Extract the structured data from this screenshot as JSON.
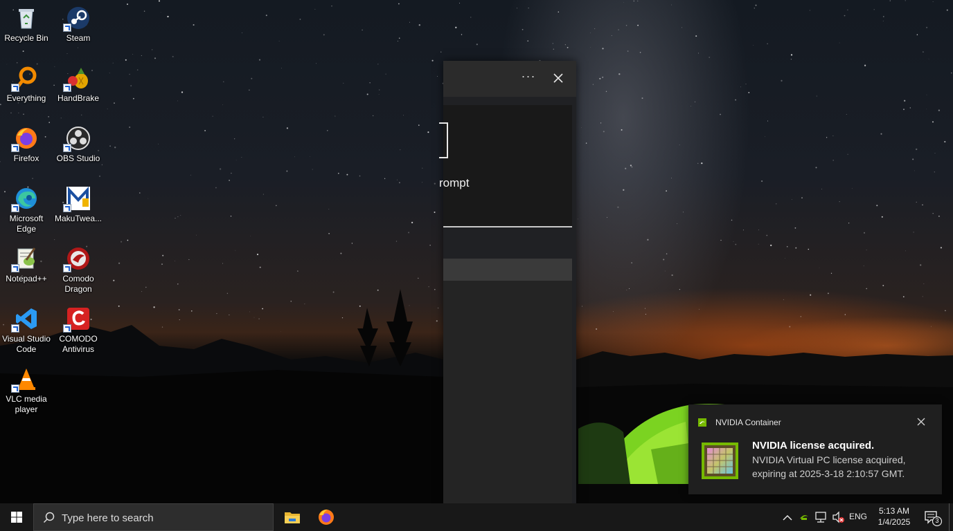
{
  "desktop": {
    "icons": [
      {
        "label": "Recycle Bin",
        "icon": "recycle-bin-icon"
      },
      {
        "label": "Steam",
        "icon": "steam-icon"
      },
      {
        "label": "Everything",
        "icon": "everything-icon"
      },
      {
        "label": "HandBrake",
        "icon": "handbrake-icon"
      },
      {
        "label": "Firefox",
        "icon": "firefox-icon"
      },
      {
        "label": "OBS Studio",
        "icon": "obs-studio-icon"
      },
      {
        "label": "Microsoft Edge",
        "icon": "edge-icon"
      },
      {
        "label": "MakuTwea...",
        "icon": "makutweaker-icon"
      },
      {
        "label": "Notepad++",
        "icon": "notepadpp-icon"
      },
      {
        "label": "Comodo Dragon",
        "icon": "comodo-dragon-icon"
      },
      {
        "label": "Visual Studio Code",
        "icon": "vscode-icon"
      },
      {
        "label": "COMODO Antivirus",
        "icon": "comodo-antivirus-icon"
      },
      {
        "label": "VLC media player",
        "icon": "vlc-icon"
      }
    ]
  },
  "panel": {
    "more_label": "···",
    "prompt_text": "rompt"
  },
  "notification": {
    "app_name": "NVIDIA Container",
    "title": "NVIDIA license acquired.",
    "body": "NVIDIA Virtual PC license acquired, expiring at 2025-3-18 2:10:57 GMT.",
    "accent_color": "#76b900"
  },
  "taskbar": {
    "search_placeholder": "Type here to search",
    "pinned": [
      "file-explorer-icon",
      "firefox-icon"
    ],
    "language": "ENG",
    "time": "5:13 AM",
    "date": "1/4/2025",
    "notification_count": "3"
  }
}
